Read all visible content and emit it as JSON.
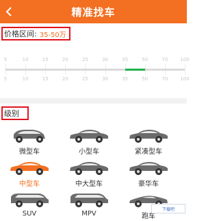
{
  "header": {
    "title": "精准找车",
    "back_icon": "chevron-left-icon"
  },
  "price": {
    "label": "价格区间:",
    "value": "35-50万",
    "ticks_top": [
      "5",
      "10",
      "15",
      "20",
      "25",
      "30",
      "35",
      "50",
      "70",
      "100"
    ],
    "ticks_bottom": [
      "5",
      "10",
      "15",
      "20",
      "25",
      "30",
      "35",
      "50",
      "70",
      "100"
    ],
    "selected_range": [
      35,
      50
    ],
    "range_color": "#1fb24a"
  },
  "category": {
    "label": "级别",
    "items": [
      {
        "label": "微型车",
        "icon": "micro-car-icon",
        "selected": false
      },
      {
        "label": "小型车",
        "icon": "small-car-icon",
        "selected": false
      },
      {
        "label": "紧凑型车",
        "icon": "compact-car-icon",
        "selected": false
      },
      {
        "label": "中型车",
        "icon": "mid-size-car-icon",
        "selected": true
      },
      {
        "label": "中大型车",
        "icon": "mid-large-car-icon",
        "selected": false
      },
      {
        "label": "豪华车",
        "icon": "luxury-car-icon",
        "selected": false
      },
      {
        "label": "SUV",
        "icon": "suv-icon",
        "selected": false
      },
      {
        "label": "MPV",
        "icon": "mpv-icon",
        "selected": false
      },
      {
        "label": "跑车",
        "icon": "sports-car-icon",
        "selected": false
      }
    ]
  },
  "watermark": {
    "text": "下载吧"
  },
  "colors": {
    "brand": "#f36f21",
    "highlight_border": "#e0141e",
    "car_selected": "#f36f21",
    "car_default": "#6b6b6b"
  }
}
